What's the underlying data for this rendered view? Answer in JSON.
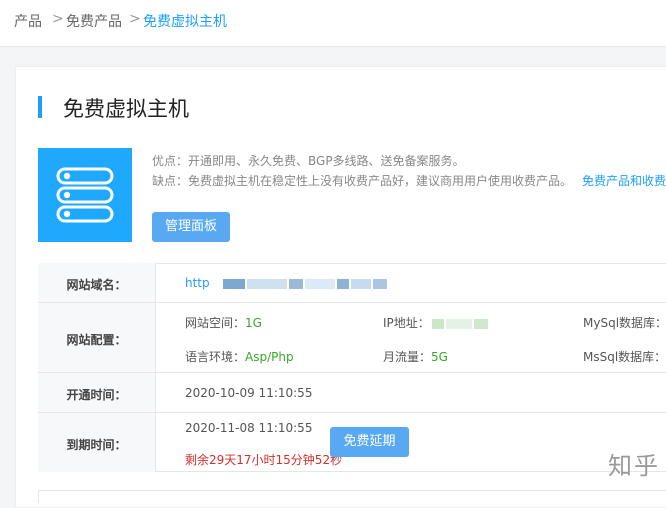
{
  "breadcrumb": {
    "items": [
      "产品",
      "免费产品",
      "免费虚拟主机"
    ],
    "separator": ">"
  },
  "page_title": "免费虚拟主机",
  "product": {
    "icon": "server-icon",
    "advantages": "优点：开通即用、永久免费、BGP多线路、送免备案服务。",
    "disadvantages": "缺点：免费虚拟主机在稳定性上没有收费产品好，建议商用用户使用收费产品。",
    "compare_link": "免费产品和收费产品",
    "manage_button": "管理面板"
  },
  "table": {
    "domain_label": "网站域名：",
    "domain_value": "http",
    "config_label": "网站配置：",
    "config": {
      "space_label": "网站空间：",
      "space_value": "1G",
      "ip_label": "IP地址：",
      "mysql_label": "MySql数据库：",
      "lang_label": "语言环境：",
      "lang_value": "Asp/Php",
      "traffic_label": "月流量：",
      "traffic_value": "5G",
      "mssql_label": "MsSql数据库："
    },
    "open_label": "开通时间：",
    "open_value": "2020-10-09 11:10:55",
    "expire_label": "到期时间：",
    "expire_value": "2020-11-08 11:10:55",
    "remaining": "剩余29天17小时15分钟52秒",
    "extend_button": "免费延期"
  },
  "colors": {
    "accent": "#1e9fff",
    "button": "#58a9f2",
    "green": "#3aa629",
    "red": "#d42e2e"
  },
  "watermark": "知乎"
}
